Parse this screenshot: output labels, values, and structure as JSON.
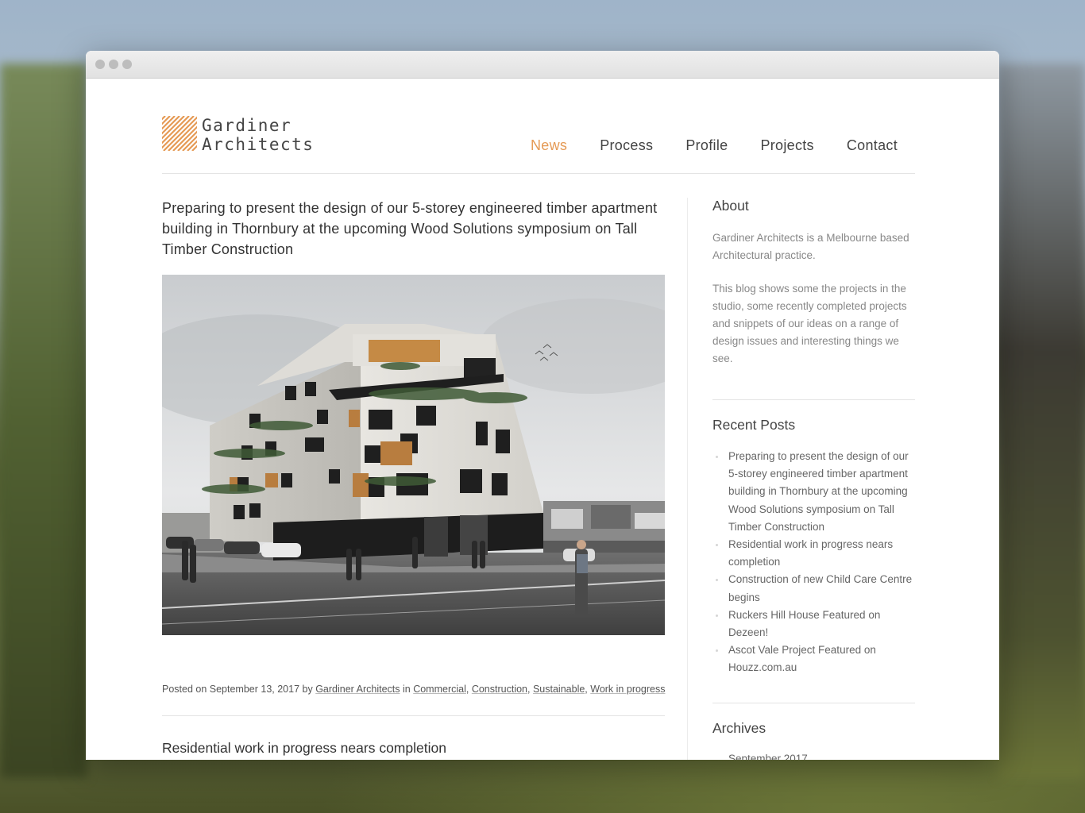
{
  "brand": {
    "line1": "Gardiner",
    "line2": "Architects",
    "accent_color": "#e59a55"
  },
  "nav": [
    {
      "label": "News",
      "active": true
    },
    {
      "label": "Process",
      "active": false
    },
    {
      "label": "Profile",
      "active": false
    },
    {
      "label": "Projects",
      "active": false
    },
    {
      "label": "Contact",
      "active": false
    }
  ],
  "main": {
    "post1": {
      "title": "Preparing to present the design of our 5-storey engineered timber apartment building in Thornbury at the upcoming Wood Solutions symposium on Tall Timber Construction",
      "image_icon": "building-rendering-image",
      "meta": {
        "prefix": "Posted on September 13, 2017 by ",
        "author": "Gardiner Architects",
        "in": " in ",
        "categories": [
          "Commercial",
          "Construction",
          "Sustainable",
          "Work in progress"
        ]
      }
    },
    "post2": {
      "title": "Residential work in progress nears completion"
    }
  },
  "sidebar": {
    "about": {
      "title": "About",
      "p1": "Gardiner Architects is a Melbourne based Architectural practice.",
      "p2": "This blog shows some the projects in the studio, some recently completed projects and snippets of our ideas on a range of design issues and interesting things we see."
    },
    "recent": {
      "title": "Recent Posts",
      "items": [
        "Preparing to present the design of our 5-storey engineered timber apartment building in Thornbury at the upcoming Wood Solutions symposium on Tall Timber Construction",
        "Residential work in progress nears completion",
        "Construction of new Child Care Centre begins",
        "Ruckers Hill House Featured on Dezeen!",
        "Ascot Vale Project Featured on Houzz.com.au"
      ]
    },
    "archives": {
      "title": "Archives",
      "items": [
        "September 2017"
      ]
    }
  }
}
